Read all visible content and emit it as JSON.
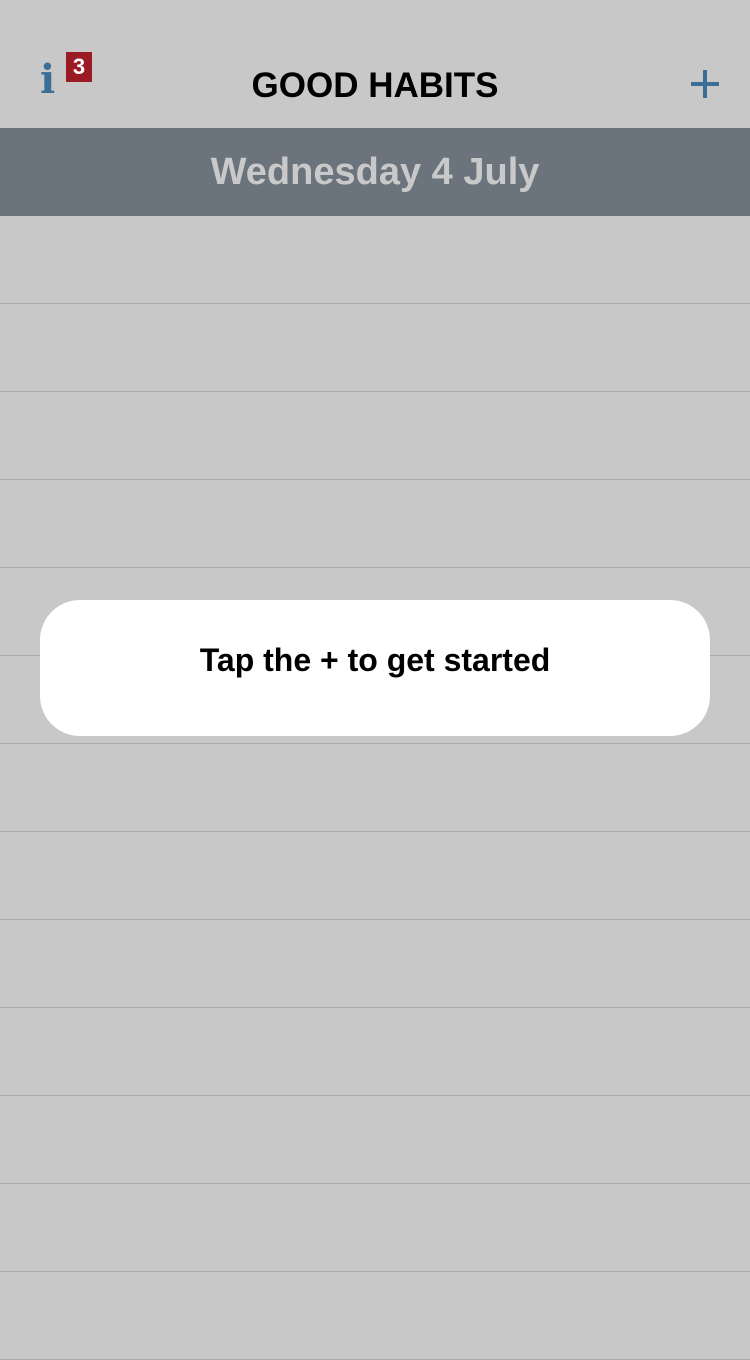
{
  "nav": {
    "info_glyph": "i",
    "badge_count": "3",
    "title": "GOOD HABITS",
    "add_icon": "plus-icon",
    "info_icon": "info-icon"
  },
  "date_header": {
    "label": "Wednesday 4 July"
  },
  "hint": {
    "text": "Tap the + to get started"
  },
  "rows": [
    {},
    {},
    {},
    {},
    {},
    {},
    {},
    {},
    {},
    {},
    {},
    {},
    {}
  ],
  "colors": {
    "background": "#c8c8c8",
    "accent_blue": "#3a6e96",
    "badge_red": "#9b1b24",
    "date_bar_bg": "#6b737c",
    "date_text": "#c9c9c9",
    "row_divider": "#a9a9a9",
    "card_bg": "#ffffff"
  }
}
